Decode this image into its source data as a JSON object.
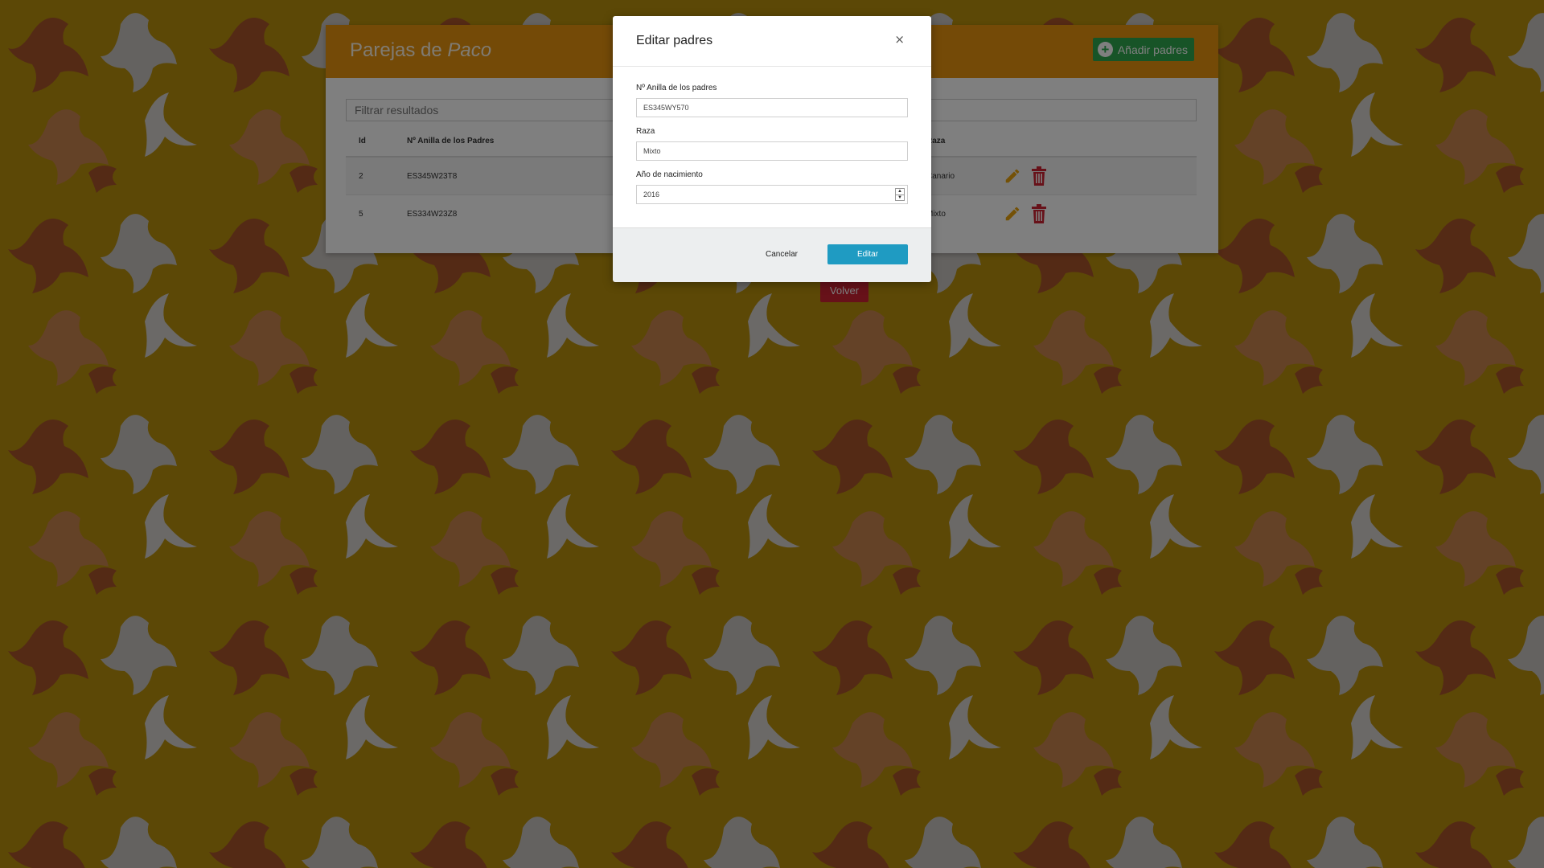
{
  "page": {
    "title_prefix": "Parejas de",
    "title_name": "Paco",
    "add_button_label": "Añadir padres",
    "filter_placeholder": "Filtrar resultados",
    "back_button_label": "Volver"
  },
  "table": {
    "columns": [
      "Id",
      "Nº Anilla de los Padres",
      "Raza"
    ],
    "rows": [
      {
        "id": "2",
        "ring": "ES345W23T8",
        "breed": "Canario"
      },
      {
        "id": "5",
        "ring": "ES334W23Z8",
        "breed": "Mixto"
      }
    ]
  },
  "modal": {
    "title": "Editar padres",
    "close_label": "×",
    "ring_label": "Nº Anilla de los padres",
    "ring_value": "ES345WY570",
    "breed_label": "Raza",
    "breed_value": "Mixto",
    "year_label": "Año de nacimiento",
    "year_value": "2016",
    "cancel_label": "Cancelar",
    "submit_label": "Editar"
  },
  "colors": {
    "background": "#b8900c",
    "header": "#e8940f",
    "add_button": "#2fa84f",
    "edit_icon": "#e8a20c",
    "delete_icon": "#cf2232",
    "submit_button": "#1f9bc2",
    "back_button": "#cf2232"
  },
  "icons": {
    "add": "plus-circle-icon",
    "edit": "pencil-icon",
    "delete": "trash-icon",
    "close": "close-icon"
  }
}
